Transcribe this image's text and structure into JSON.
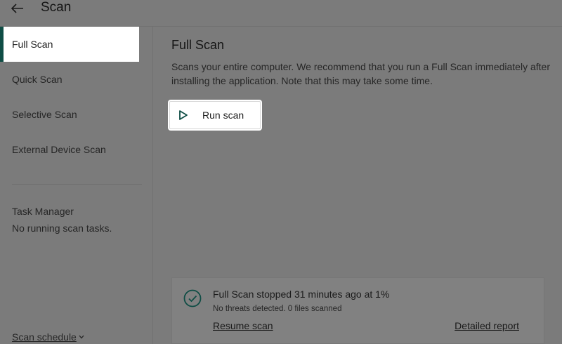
{
  "header": {
    "back_icon": "arrow-left-icon",
    "title": "Scan"
  },
  "sidebar": {
    "items": [
      {
        "label": "Full Scan",
        "active": true
      },
      {
        "label": "Quick Scan",
        "active": false
      },
      {
        "label": "Selective Scan",
        "active": false
      },
      {
        "label": "External Device Scan",
        "active": false
      }
    ],
    "task_manager": {
      "title": "Task Manager",
      "status": "No running scan tasks."
    },
    "schedule_label": "Scan schedule",
    "schedule_icon": "chevron-down-icon"
  },
  "main": {
    "title": "Full Scan",
    "description": "Scans your entire computer. We recommend that you run a Full Scan immediately after installing the application. Note that this may take some time.",
    "run_button": {
      "label": "Run scan",
      "icon": "play-icon"
    }
  },
  "status_card": {
    "icon": "check-circle-icon",
    "headline": "Full Scan stopped 31 minutes ago at 1%",
    "details": "No threats detected. 0 files scanned",
    "resume_label": "Resume scan",
    "report_label": "Detailed report"
  },
  "colors": {
    "accent": "#0f4d45",
    "overlay_background": "#7b7b7b",
    "highlight": "#ffffff"
  }
}
